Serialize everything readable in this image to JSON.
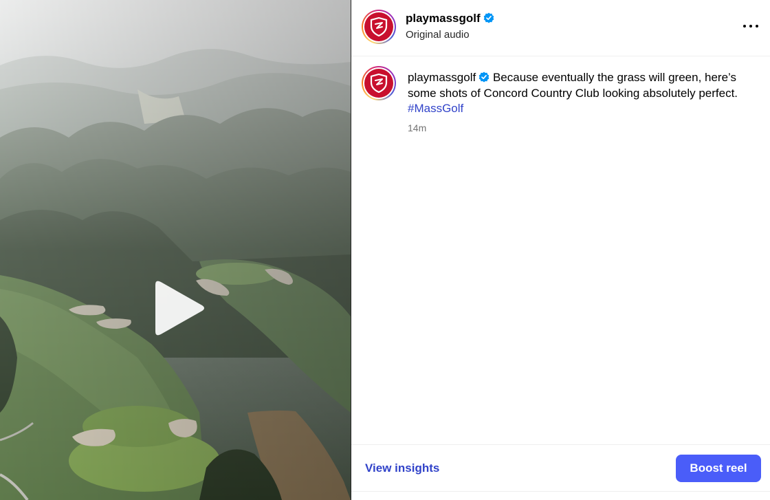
{
  "video": {
    "play_icon": "play-icon"
  },
  "header": {
    "username": "playmassgolf",
    "subtitle": "Original audio",
    "more_icon": "more-horizontal-icon"
  },
  "caption": {
    "username": "playmassgolf",
    "text": "Because eventually the grass will green, here’s some shots of Concord Country Club looking absolutely perfect.",
    "hashtag": "#MassGolf",
    "timestamp": "14m"
  },
  "footer": {
    "insights_label": "View insights",
    "boost_label": "Boost reel"
  },
  "colors": {
    "brand_red": "#c8102e",
    "link_blue": "#3143c9",
    "boost_button": "#4a5df9",
    "verified_blue": "#0095f6"
  }
}
